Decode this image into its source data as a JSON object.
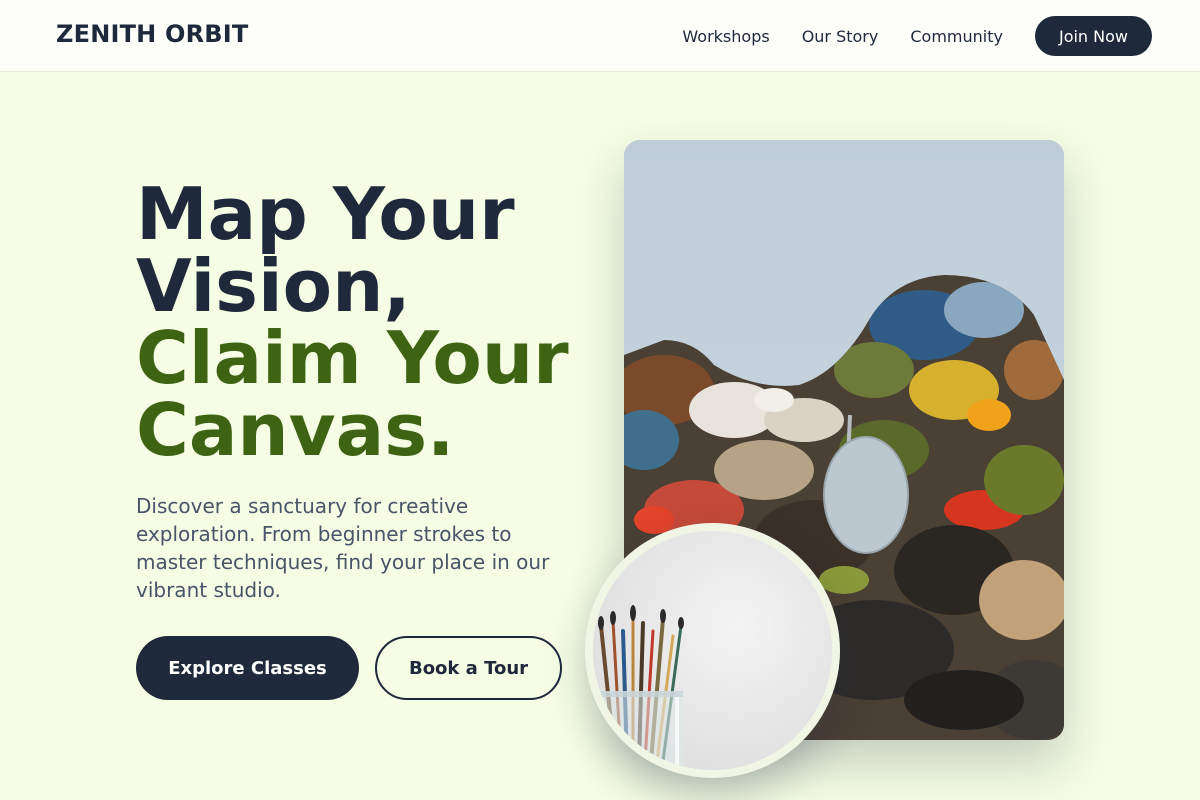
{
  "brand": "ZENITH ORBIT",
  "nav": {
    "links": [
      "Workshops",
      "Our Story",
      "Community"
    ],
    "cta": "Join Now"
  },
  "hero": {
    "headline": {
      "line1": "Map Your",
      "line2": "Vision,",
      "line3": "Claim Your",
      "line4": "Canvas."
    },
    "subtext": "Discover a sanctuary for creative exploration. From beginner strokes to master techniques, find your place in our vibrant studio.",
    "primary_cta": "Explore Classes",
    "secondary_cta": "Book a Tour"
  },
  "images": {
    "main": "paint-palette-photo",
    "round": "paintbrushes-jar-photo"
  },
  "colors": {
    "background": "#f5fde4",
    "navy": "#1e293b",
    "green": "#3e6313",
    "muted_text": "#475569"
  }
}
